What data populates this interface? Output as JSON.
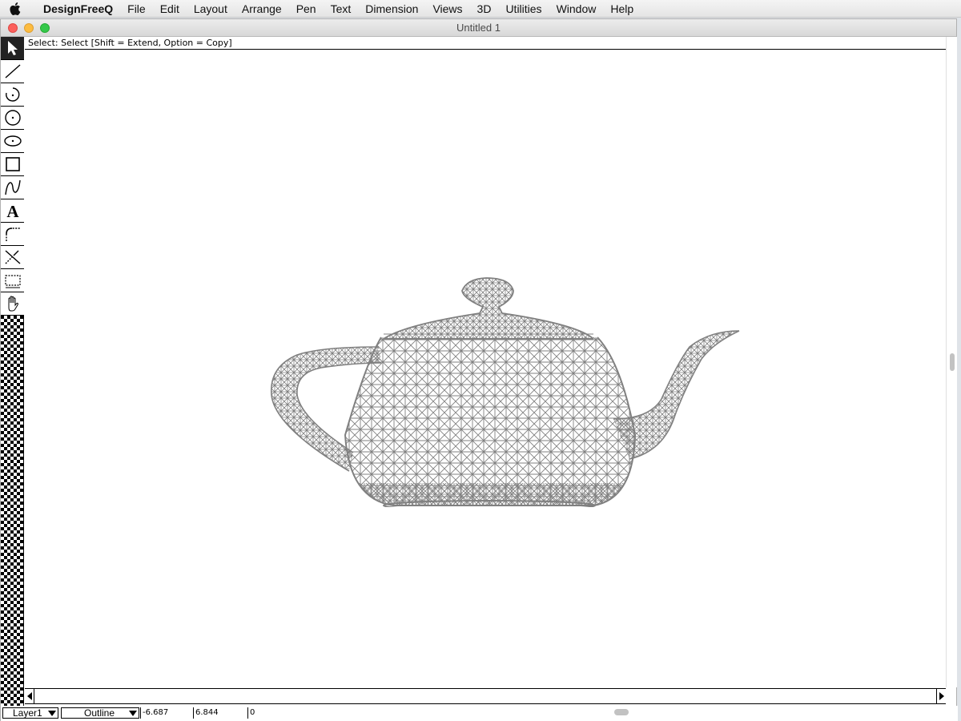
{
  "menubar": {
    "app_name": "DesignFreeQ",
    "items": [
      "File",
      "Edit",
      "Layout",
      "Arrange",
      "Pen",
      "Text",
      "Dimension",
      "Views",
      "3D",
      "Utilities",
      "Window",
      "Help"
    ]
  },
  "window": {
    "title": "Untitled 1"
  },
  "prompt": {
    "text": "Select: Select  [Shift = Extend, Option = Copy]"
  },
  "toolbox": {
    "tools": [
      {
        "name": "select-tool",
        "icon": "arrow-icon",
        "active": true
      },
      {
        "name": "line-tool",
        "icon": "line-icon"
      },
      {
        "name": "arc-tool",
        "icon": "arc-icon"
      },
      {
        "name": "circle-tool",
        "icon": "circle-icon"
      },
      {
        "name": "ellipse-tool",
        "icon": "ellipse-icon"
      },
      {
        "name": "rectangle-tool",
        "icon": "rectangle-icon"
      },
      {
        "name": "curve-tool",
        "icon": "curve-icon"
      },
      {
        "name": "text-tool",
        "icon": "text-icon",
        "glyph": "A"
      },
      {
        "name": "fillet-tool",
        "icon": "fillet-icon"
      },
      {
        "name": "trim-tool",
        "icon": "trim-icon"
      },
      {
        "name": "zoom-box-tool",
        "icon": "zoom-box-icon"
      },
      {
        "name": "pan-tool",
        "icon": "hand-icon"
      }
    ]
  },
  "drawing": {
    "object": "teapot-wireframe",
    "stroke_color": "#808080"
  },
  "statusbar": {
    "layer": "Layer1",
    "render_mode": "Outline",
    "x": "-6.687",
    "y": "6.844",
    "z": "0"
  }
}
